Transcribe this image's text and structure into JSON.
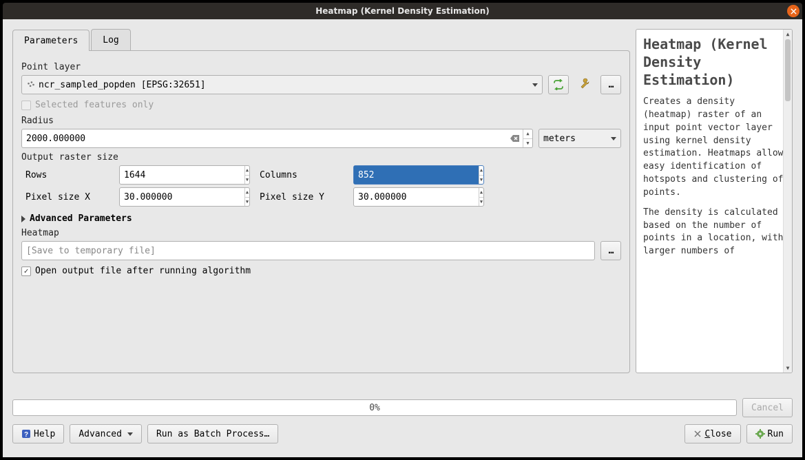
{
  "window": {
    "title": "Heatmap (Kernel Density Estimation)"
  },
  "tabs": {
    "parameters": "Parameters",
    "log": "Log"
  },
  "params": {
    "point_layer_label": "Point layer",
    "point_layer_value": "ncr_sampled_popden [EPSG:32651]",
    "selected_features_label": "Selected features only",
    "radius_label": "Radius",
    "radius_value": "2000.000000",
    "radius_unit": "meters",
    "output_raster_size_label": "Output raster size",
    "rows_label": "Rows",
    "rows_value": "1644",
    "columns_label": "Columns",
    "columns_value": "852",
    "pixel_x_label": "Pixel size X",
    "pixel_x_value": "30.000000",
    "pixel_y_label": "Pixel size Y",
    "pixel_y_value": "30.000000",
    "advanced_label": "Advanced Parameters",
    "heatmap_label": "Heatmap",
    "heatmap_placeholder": "[Save to temporary file]",
    "open_output_label": "Open output file after running algorithm"
  },
  "help": {
    "title": "Heatmap (Kernel Density Estimation)",
    "p1": "Creates a density (heatmap) raster of an input point vector layer using kernel density estimation. Heatmaps allow easy identification of hotspots and clustering of points.",
    "p2": "The density is calculated based on the number of points in a location, with larger numbers of"
  },
  "progress": {
    "text": "0%"
  },
  "buttons": {
    "cancel": "Cancel",
    "help": "Help",
    "advanced": "Advanced",
    "batch": "Run as Batch Process…",
    "close": "Close",
    "run": "Run"
  }
}
